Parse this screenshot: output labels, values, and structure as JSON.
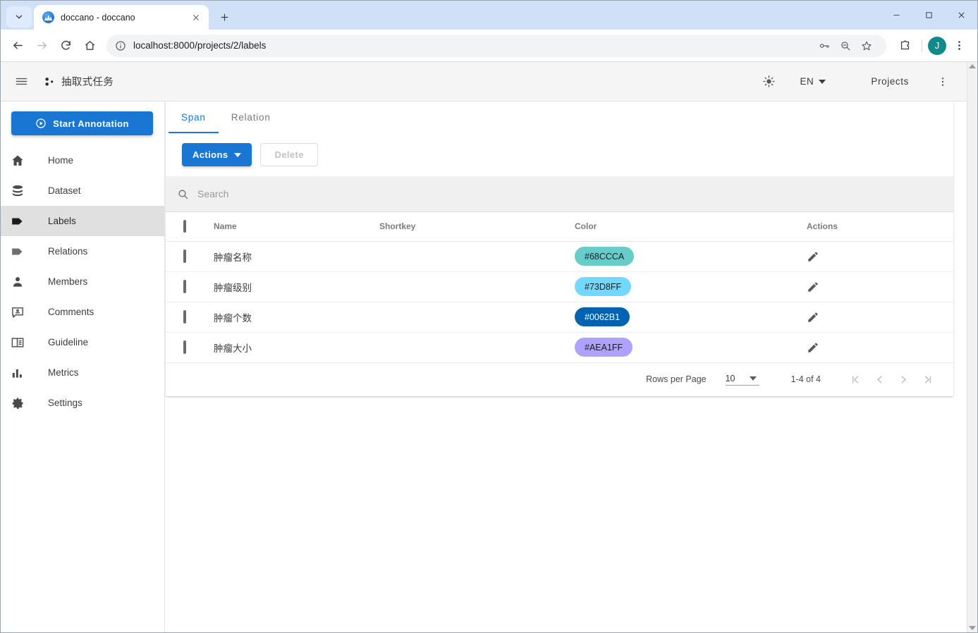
{
  "browser": {
    "tab": {
      "title": "doccano - doccano",
      "favicon_icon": "doccano-favicon"
    },
    "tab_search_icon": "chevron-down-icon",
    "new_tab_icon": "plus-icon",
    "tab_close_icon": "close-icon",
    "nav": {
      "back_icon": "arrow-left-icon",
      "forward_icon": "arrow-right-icon",
      "reload_icon": "reload-icon",
      "home_icon": "home-icon"
    },
    "omnibox": {
      "url": "localhost:8000/projects/2/labels",
      "info_icon": "info-circle-icon",
      "password_icon": "key-icon",
      "zoom_icon": "zoom-out-icon",
      "bookmark_icon": "star-icon"
    },
    "extensions_icon": "puzzle-icon",
    "profile": {
      "initial": "J",
      "color": "#0f8a8a"
    },
    "browser_menu_icon": "kebab-menu-icon",
    "window_controls": {
      "minimize_icon": "minimize-icon",
      "maximize_icon": "maximize-icon",
      "close_icon": "close-icon"
    }
  },
  "appbar": {
    "menu_icon": "hamburger-icon",
    "brand_icon": "doccano-logo-icon",
    "project_title": "抽取式任务",
    "theme_icon": "sun-icon",
    "language": "EN",
    "language_caret_icon": "caret-down-icon",
    "projects_label": "Projects",
    "overflow_icon": "kebab-menu-icon"
  },
  "sidebar": {
    "start_button": {
      "label": "Start Annotation",
      "icon": "play-circle-icon"
    },
    "items": [
      {
        "label": "Home",
        "icon": "home-icon",
        "active": false
      },
      {
        "label": "Dataset",
        "icon": "database-icon",
        "active": false
      },
      {
        "label": "Labels",
        "icon": "label-tag-icon",
        "active": true
      },
      {
        "label": "Relations",
        "icon": "label-tag-outline-icon",
        "active": false
      },
      {
        "label": "Members",
        "icon": "person-icon",
        "active": false
      },
      {
        "label": "Comments",
        "icon": "comment-icon",
        "active": false
      },
      {
        "label": "Guideline",
        "icon": "book-icon",
        "active": false
      },
      {
        "label": "Metrics",
        "icon": "bar-chart-icon",
        "active": false
      },
      {
        "label": "Settings",
        "icon": "gear-icon",
        "active": false
      }
    ]
  },
  "main": {
    "tabs": [
      {
        "label": "Span",
        "active": true
      },
      {
        "label": "Relation",
        "active": false
      }
    ],
    "toolbar": {
      "actions_label": "Actions",
      "actions_caret_icon": "caret-down-icon",
      "delete_label": "Delete",
      "delete_disabled": true
    },
    "search": {
      "placeholder": "Search",
      "value": "",
      "icon": "search-icon"
    },
    "table": {
      "columns": [
        "Name",
        "Shortkey",
        "Color",
        "Actions"
      ],
      "header_checkbox_checked": false,
      "edit_icon": "pencil-icon",
      "rows": [
        {
          "checked": false,
          "name": "肿瘤名称",
          "shortkey": "",
          "color": "#68CCCA",
          "text_color": "#1a1a1a"
        },
        {
          "checked": false,
          "name": "肿瘤级别",
          "shortkey": "",
          "color": "#73D8FF",
          "text_color": "#1a1a1a"
        },
        {
          "checked": false,
          "name": "肿瘤个数",
          "shortkey": "",
          "color": "#0062B1",
          "text_color": "#ffffff"
        },
        {
          "checked": false,
          "name": "肿瘤大小",
          "shortkey": "",
          "color": "#AEA1FF",
          "text_color": "#1a1a1a"
        }
      ]
    },
    "pagination": {
      "rows_per_page_label": "Rows per Page",
      "rows_per_page_value": "10",
      "range_label": "1-4 of 4",
      "first_icon": "first-page-icon",
      "prev_icon": "prev-page-icon",
      "next_icon": "next-page-icon",
      "last_icon": "last-page-icon"
    }
  },
  "theme": {
    "accent": "#1976d2",
    "appbar_bg": "#f5f5f5",
    "active_nav_bg": "#e0e0e0",
    "search_bg": "#f0f0f0"
  }
}
